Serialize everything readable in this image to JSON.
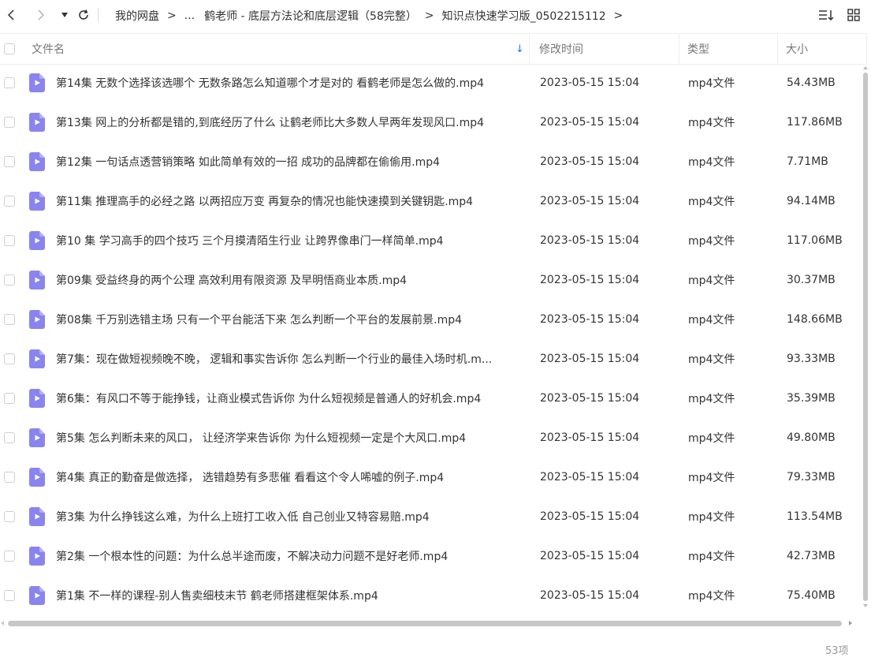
{
  "toolbar": {
    "back_icon": "chevron-left-icon",
    "forward_icon": "chevron-right-icon",
    "history_icon": "caret-down-icon",
    "refresh_icon": "refresh-icon",
    "sort_icon": "sort-list-icon",
    "grid_icon": "grid-view-icon"
  },
  "breadcrumb": {
    "items": [
      "我的网盘",
      "...",
      "鹤老师 - 底层方法论和底层逻辑（58完整）",
      "知识点快速学习版_0502215112"
    ],
    "separator": ">"
  },
  "table": {
    "headers": {
      "name": "文件名",
      "modified": "修改时间",
      "type": "类型",
      "size": "大小"
    },
    "sort_indicator": "↓",
    "rows": [
      {
        "name": "第14集 无数个选择该选哪个 无数条路怎么知道哪个才是对的 看鹤老师是怎么做的.mp4",
        "modified": "2023-05-15 15:04",
        "type": "mp4文件",
        "size": "54.43MB"
      },
      {
        "name": "第13集 网上的分析都是错的,到底经历了什么 让鹤老师比大多数人早两年发现风口.mp4",
        "modified": "2023-05-15 15:04",
        "type": "mp4文件",
        "size": "117.86MB"
      },
      {
        "name": "第12集 一句话点透营销策略 如此简单有效的一招 成功的品牌都在偷偷用.mp4",
        "modified": "2023-05-15 15:04",
        "type": "mp4文件",
        "size": "7.71MB"
      },
      {
        "name": "第11集 推理高手的必经之路 以两招应万变 再复杂的情况也能快速摸到关键钥匙.mp4",
        "modified": "2023-05-15 15:04",
        "type": "mp4文件",
        "size": "94.14MB"
      },
      {
        "name": "第10 集 学习高手的四个技巧 三个月摸清陌生行业 让跨界像串门一样简单.mp4",
        "modified": "2023-05-15 15:04",
        "type": "mp4文件",
        "size": "117.06MB"
      },
      {
        "name": "第09集 受益终身的两个公理 高效利用有限资源 及早明悟商业本质.mp4",
        "modified": "2023-05-15 15:04",
        "type": "mp4文件",
        "size": "30.37MB"
      },
      {
        "name": "第08集 千万别选错主场 只有一个平台能活下来 怎么判断一个平台的发展前景.mp4",
        "modified": "2023-05-15 15:04",
        "type": "mp4文件",
        "size": "148.66MB"
      },
      {
        "name": "第7集：现在做短视频晚不晚， 逻辑和事实告诉你 怎么判断一个行业的最佳入场时机.m...",
        "modified": "2023-05-15 15:04",
        "type": "mp4文件",
        "size": "93.33MB"
      },
      {
        "name": "第6集：有风口不等于能挣钱，让商业模式告诉你 为什么短视频是普通人的好机会.mp4",
        "modified": "2023-05-15 15:04",
        "type": "mp4文件",
        "size": "35.39MB"
      },
      {
        "name": "第5集 怎么判断未来的风口， 让经济学来告诉你 为什么短视频一定是个大风口.mp4",
        "modified": "2023-05-15 15:04",
        "type": "mp4文件",
        "size": "49.80MB"
      },
      {
        "name": "第4集 真正的勤奋是做选择， 选错趋势有多悲催 看看这个令人唏嘘的例子.mp4",
        "modified": "2023-05-15 15:04",
        "type": "mp4文件",
        "size": "79.33MB"
      },
      {
        "name": "第3集 为什么挣钱这么难，为什么上班打工收入低 自己创业又特容易赔.mp4",
        "modified": "2023-05-15 15:04",
        "type": "mp4文件",
        "size": "113.54MB"
      },
      {
        "name": "第2集 一个根本性的问题：为什么总半途而废，不解决动力问题不是好老师.mp4",
        "modified": "2023-05-15 15:04",
        "type": "mp4文件",
        "size": "42.73MB"
      },
      {
        "name": "第1集 不一样的课程-别人售卖细枝末节 鹤老师搭建框架体系.mp4",
        "modified": "2023-05-15 15:04",
        "type": "mp4文件",
        "size": "75.40MB"
      }
    ]
  },
  "footer": {
    "count": "53项"
  },
  "colors": {
    "accent": "#1677ff",
    "file_icon": "#8a84ee",
    "file_icon_light": "#b3aef5"
  }
}
